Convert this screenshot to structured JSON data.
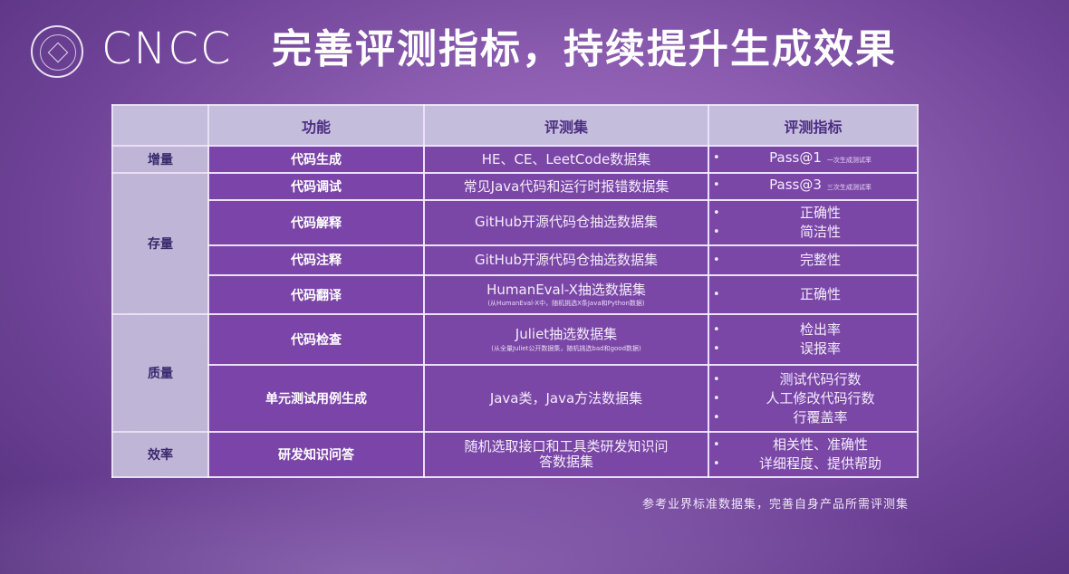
{
  "header": {
    "logo": "CNCC",
    "title": "完善评测指标，持续提升生成效果"
  },
  "table": {
    "columns": [
      "",
      "功能",
      "评测集",
      "评测指标"
    ],
    "groups": [
      {
        "name": "增量",
        "rows": [
          {
            "func": "代码生成",
            "dataset": "HE、CE、LeetCode数据集",
            "dataset_note": "",
            "metrics": [
              "Pass@1"
            ],
            "metric_note": "一次生成测试率"
          }
        ]
      },
      {
        "name": "存量",
        "rows": [
          {
            "func": "代码调试",
            "dataset": "常见Java代码和运行时报错数据集",
            "dataset_note": "",
            "metrics": [
              "Pass@3"
            ],
            "metric_note": "三次生成测试率"
          },
          {
            "func": "代码解释",
            "dataset": "GitHub开源代码仓抽选数据集",
            "dataset_note": "",
            "metrics": [
              "正确性",
              "简洁性"
            ],
            "metric_note": ""
          },
          {
            "func": "代码注释",
            "dataset": "GitHub开源代码仓抽选数据集",
            "dataset_note": "",
            "metrics": [
              "完整性"
            ],
            "metric_note": ""
          },
          {
            "func": "代码翻译",
            "dataset": "HumanEval-X抽选数据集",
            "dataset_note": "(从HumanEval-X中，随机挑选X条Java和Python数据)",
            "metrics": [
              "正确性"
            ],
            "metric_note": ""
          }
        ]
      },
      {
        "name": "质量",
        "rows": [
          {
            "func": "代码检查",
            "dataset": "Juliet抽选数据集",
            "dataset_note": "(从全量Juliet公开数据集，随机挑选bad和good数据)",
            "metrics": [
              "检出率",
              "误报率"
            ],
            "metric_note": ""
          },
          {
            "func": "单元测试用例生成",
            "dataset": "Java类，Java方法数据集",
            "dataset_note": "",
            "metrics": [
              "测试代码行数",
              "人工修改代码行数",
              "行覆盖率"
            ],
            "metric_note": ""
          }
        ]
      },
      {
        "name": "效率",
        "rows": [
          {
            "func": "研发知识问答",
            "dataset": "随机选取接口和工具类研发知识问答数据集",
            "dataset_note": "",
            "metrics": [
              "相关性、准确性",
              "详细程度、提供帮助"
            ],
            "metric_note": ""
          }
        ]
      }
    ]
  },
  "footer": "参考业界标准数据集，完善自身产品所需评测集"
}
